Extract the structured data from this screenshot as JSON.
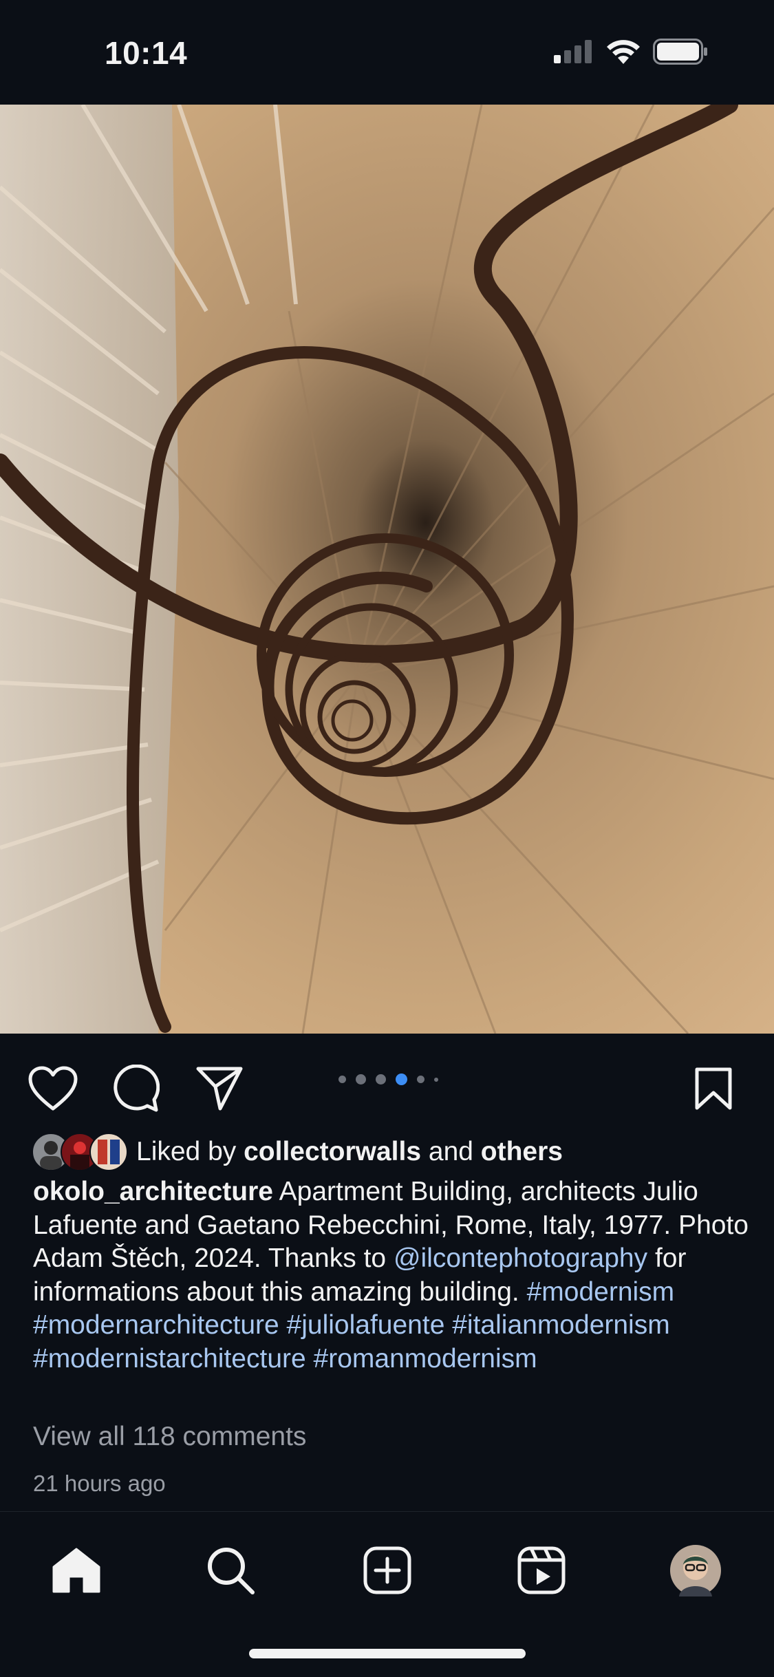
{
  "status_bar": {
    "time": "10:14"
  },
  "post": {
    "image_icon": "spiral-staircase-photo",
    "carousel": {
      "count": 6,
      "active_index": 3
    },
    "liked_by": {
      "prefix": "Liked by ",
      "user": "collectorwalls",
      "middle": " and ",
      "suffix": "others"
    },
    "caption": {
      "username": "okolo_architecture",
      "text_1": " Apartment Building, architects Julio Lafuente and Gaetano Rebecchini, Rome, Italy, 1977. Photo Adam Štěch, 2024. Thanks to ",
      "mention": "@ilcontephotography",
      "text_2": " for informations about this amazing building. ",
      "hashtags": [
        "#modernism",
        "#modernarchitecture",
        "#juliolafuente",
        "#italianmodernism",
        "#modernistarchitecture",
        "#romanmodernism"
      ]
    },
    "view_comments": "View all 118 comments",
    "time_ago": "21 hours ago"
  },
  "colors": {
    "background": "#0b0f16",
    "link": "#a8c7f0",
    "active_dot": "#3d8ef5"
  },
  "nav": [
    "home-icon",
    "search-icon",
    "create-icon",
    "reels-icon",
    "profile-avatar"
  ]
}
